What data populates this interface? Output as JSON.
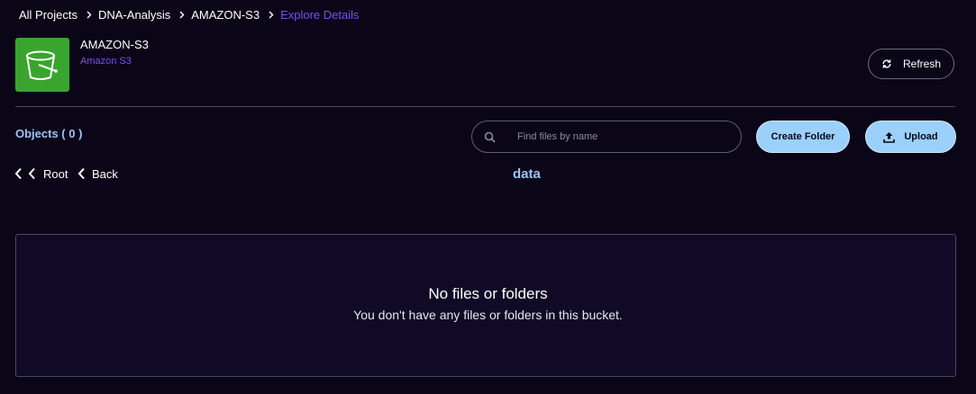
{
  "breadcrumb": {
    "items": [
      {
        "label": "All Projects"
      },
      {
        "label": "DNA-Analysis"
      },
      {
        "label": "AMAZON-S3"
      },
      {
        "label": "Explore Details"
      }
    ]
  },
  "header": {
    "logo_icon": "s3-bucket-icon",
    "title": "AMAZON-S3",
    "subtitle": "Amazon S3",
    "refresh_label": "Refresh"
  },
  "toolbar": {
    "objects_label": "Objects ( 0 )",
    "search_placeholder": "Find files by name",
    "search_value": "",
    "create_folder_label": "Create Folder",
    "upload_label": "Upload"
  },
  "nav": {
    "root_label": "Root",
    "back_label": "Back",
    "current_folder": "data"
  },
  "empty_state": {
    "title": "No files or folders",
    "message": "You don't have any files or folders in this bucket."
  },
  "colors": {
    "background": "#0a0618",
    "accent_purple": "#7b4ff0",
    "button_blue": "#9bd0fb",
    "label_blue": "#9fc3f5",
    "logo_green": "#3aa52e"
  }
}
